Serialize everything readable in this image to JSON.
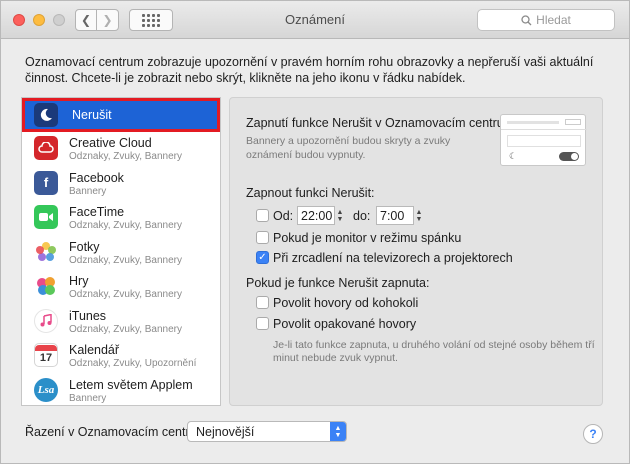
{
  "window": {
    "title": "Oznámení"
  },
  "toolbar": {
    "search_placeholder": "Hledat"
  },
  "intro_text": "Oznamovací centrum zobrazuje upozornění v pravém horním rohu obrazovky a nepřeruší vaši aktuální činnost. Chcete-li je zobrazit nebo skrýt, klikněte na jeho ikonu v řádku nabídek.",
  "apps": [
    {
      "name": "Nerušit",
      "sub": "",
      "icon": "moon-icon",
      "color": "#1b3a7a"
    },
    {
      "name": "Creative Cloud",
      "sub": "Odznaky, Zvuky, Bannery",
      "icon": "creative-cloud-icon",
      "color": "#d4262b"
    },
    {
      "name": "Facebook",
      "sub": "Bannery",
      "icon": "facebook-icon",
      "color": "#3b5998"
    },
    {
      "name": "FaceTime",
      "sub": "Odznaky, Zvuky, Bannery",
      "icon": "facetime-icon",
      "color": "#34c759"
    },
    {
      "name": "Fotky",
      "sub": "Odznaky, Zvuky, Bannery",
      "icon": "photos-icon",
      "color": "#f0a030"
    },
    {
      "name": "Hry",
      "sub": "Odznaky, Zvuky, Bannery",
      "icon": "game-center-icon",
      "color": "#8e5cd6"
    },
    {
      "name": "iTunes",
      "sub": "Odznaky, Zvuky, Bannery",
      "icon": "itunes-icon",
      "color": "#e84b8a"
    },
    {
      "name": "Kalendář",
      "sub": "Odznaky, Zvuky, Upozornění",
      "icon": "calendar-icon",
      "color": "#ffffff"
    },
    {
      "name": "Letem světem Applem",
      "sub": "Bannery",
      "icon": "letem-svetem-applem-icon",
      "color": "#2b8fc9"
    }
  ],
  "dnd_panel": {
    "heading": "Zapnutí funkce Nerušit v Oznamovacím centru",
    "description_line1": "Bannery a upozornění budou skryty a zvuky",
    "description_line2": "oznámení budou vypnuty.",
    "turn_on_label": "Zapnout funkci Nerušit:",
    "from_label": "Od:",
    "from_value": "22:00",
    "to_label": "do:",
    "to_value": "7:00",
    "opt_sleep": "Pokud je monitor v režimu spánku",
    "opt_mirror": "Při zrcadlení na televizorech a projektorech",
    "when_on_label": "Pokud je funkce Nerušit zapnuta:",
    "opt_allow_calls": "Povolit hovory od kohokoli",
    "opt_repeated": "Povolit opakované hovory",
    "repeated_note_line1": "Je-li tato funkce zapnuta, u druhého volání od stejné osoby během tří",
    "repeated_note_line2": "minut nebude zvuk vypnut.",
    "checks": {
      "time": false,
      "sleep": false,
      "mirror": true,
      "allow_calls": false,
      "repeated": false
    }
  },
  "bottom": {
    "sort_label": "Řazení v Oznamovacím centru:",
    "sort_value": "Nejnovější"
  },
  "colors": {
    "accent": "#3b82f6",
    "selection": "#1d63d6",
    "highlight_border": "#e31b23"
  }
}
